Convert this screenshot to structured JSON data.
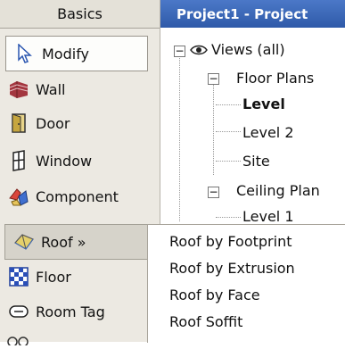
{
  "palette": {
    "header": "Basics",
    "tools": [
      {
        "label": "Modify",
        "icon": "cursor-icon"
      },
      {
        "label": "Wall",
        "icon": "wall-icon"
      },
      {
        "label": "Door",
        "icon": "door-icon"
      },
      {
        "label": "Window",
        "icon": "window-icon"
      },
      {
        "label": "Component",
        "icon": "component-icon"
      },
      {
        "label": "Roof »",
        "icon": "roof-icon"
      },
      {
        "label": "Floor",
        "icon": "floor-icon"
      },
      {
        "label": "Room Tag",
        "icon": "room-tag-icon"
      }
    ]
  },
  "browser": {
    "title": "Project1 - Project",
    "tree": [
      "Views (all)",
      "Floor Plans",
      "Level",
      "Level 2",
      "Site",
      "Ceiling Plan",
      "Level 1"
    ]
  },
  "roof_menu": {
    "items": [
      "Roof by Footprint",
      "Roof by Extrusion",
      "Roof by Face",
      "Roof Soffit"
    ]
  }
}
